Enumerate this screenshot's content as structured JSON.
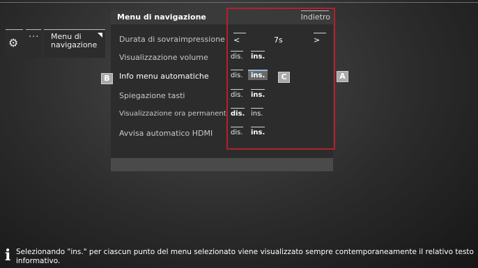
{
  "side_menu": {
    "gear_icon": "gear-icon",
    "more_label": "···",
    "navigation_label": "Menu di navigazione"
  },
  "panel": {
    "title": "Menu di navigazione",
    "back_label": "Indietro",
    "rows": [
      {
        "label": "Durata di sovraimpressione",
        "type": "stepper",
        "left": "<",
        "value": "7s",
        "right": ">"
      },
      {
        "label": "Visualizzazione volume",
        "off": "dis.",
        "on": "ins.",
        "selected": "ins."
      },
      {
        "label": "Info menu automatiche",
        "off": "dis.",
        "on": "ins.",
        "selected": "ins.",
        "active": true
      },
      {
        "label": "Spiegazione tasti",
        "off": "dis.",
        "on": "ins.",
        "selected": "ins."
      },
      {
        "label": "Visualizzazione ora permanente",
        "off": "dis.",
        "on": "ins.",
        "selected": "dis."
      },
      {
        "label": "Avvisa automatico HDMI",
        "off": "dis.",
        "on": "ins.",
        "selected": "ins."
      }
    ]
  },
  "callouts": {
    "a": "A",
    "b": "B",
    "c": "C"
  },
  "footer": {
    "icon": "info-icon",
    "text": "Selezionando \"ins.\" per ciascun punto del menu selezionato viene visualizzato sempre contemporaneamente il relativo testo informativo."
  },
  "colors": {
    "highlight_box": "#b5202e",
    "selected_underline": "#8fb8e6"
  }
}
